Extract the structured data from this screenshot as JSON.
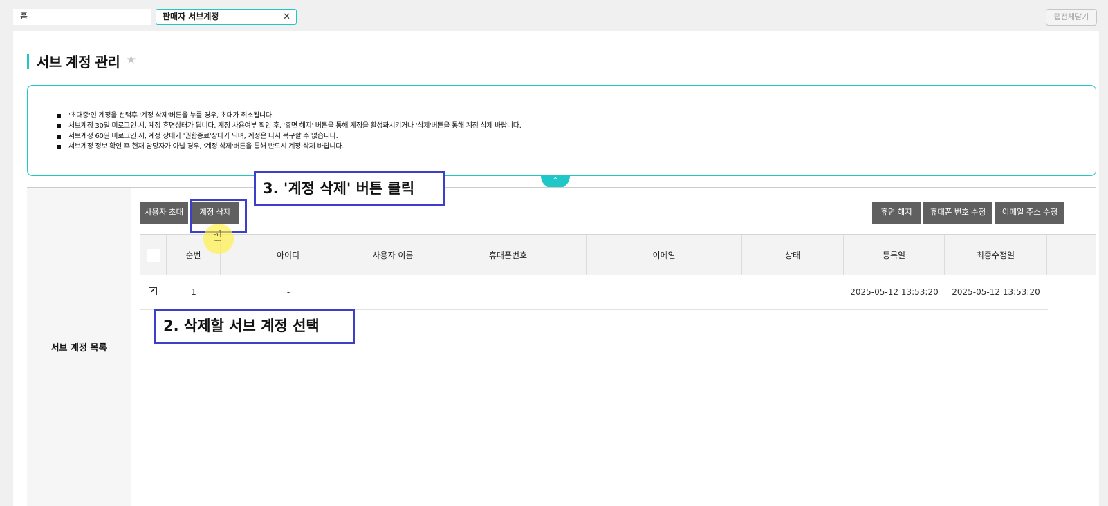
{
  "tabs": [
    {
      "label": "홈",
      "active": false
    },
    {
      "label": "판매자 서브계정",
      "active": true
    }
  ],
  "tab_close_glyph": "✕",
  "close_all_label": "탭전체닫기",
  "page": {
    "title": "서브 계정 관리",
    "star_glyph": "★"
  },
  "notice": {
    "items": [
      "'초대중'인 계정을 선택후 '계정 삭제'버튼을 누를 경우, 초대가 취소됩니다.",
      "서브계정 30일 미로그인 시, 계정 휴면상태가 됩니다. 계정 사용여부 확인 후, '휴면 해지' 버튼을 통해 계정을 활성화시키거나 '삭제'버튼을 통해 계정 삭제 바랍니다.",
      "서브계정 60일 미로그인 시, 계정 상태가 '권한종료'상태가 되며, 계정은 다시 복구할 수 없습니다.",
      "서브계정 정보 확인 후 현재 담당자가 아닐 경우, '계정 삭제'버튼을 통해 반드시 계정 삭제 바랍니다."
    ],
    "toggle_glyph": "^"
  },
  "section_label": "서브 계정 목록",
  "buttons": {
    "invite": "사용자 초대",
    "delete": "계정 삭제",
    "wake": "휴면 해지",
    "edit_phone": "휴대폰 번호 수정",
    "edit_email": "이메일 주소 수정"
  },
  "table": {
    "headers": [
      "순번",
      "아이디",
      "사용자 이름",
      "휴대폰번호",
      "이메일",
      "상태",
      "등록일",
      "최종수정일"
    ],
    "rows": [
      {
        "checked": true,
        "check_glyph": "✔",
        "no": "1",
        "id": "-",
        "name": "",
        "phone": "",
        "email": "",
        "status": "",
        "registered": "2025-05-12 13:53:20",
        "modified": "2025-05-12 13:53:20"
      }
    ]
  },
  "callouts": {
    "step3": "3. '계정 삭제' 버튼 클릭",
    "step2": "2. 삭제할 서브 계정 선택"
  },
  "cursor_glyph": "☝",
  "colors": {
    "accent": "#1fc7c7",
    "button": "#606060",
    "callout_border": "#3d3fc9"
  }
}
